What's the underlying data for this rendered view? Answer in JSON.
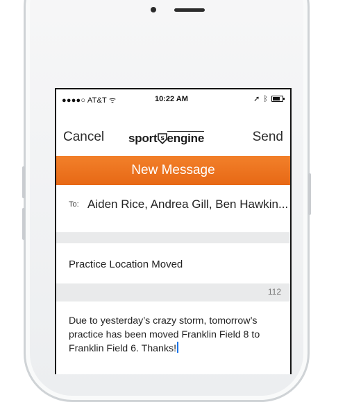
{
  "status_bar": {
    "carrier": "●●●●○ AT&T ᯤ",
    "time": "10:22 AM",
    "battery_level": 0.75
  },
  "nav": {
    "cancel_label": "Cancel",
    "logo_text_left": "sport",
    "logo_text_right": "engine",
    "send_label": "Send"
  },
  "banner": {
    "title": "New Message"
  },
  "to_field": {
    "label": "To:",
    "value": "Aiden Rice, Andrea Gill, Ben Hawkin..."
  },
  "subject": {
    "value": "Practice Location Moved"
  },
  "counter": {
    "value": "112"
  },
  "message": {
    "value": "Due to yesterday’s crazy storm, tomorrow’s practice has been moved Franklin Field 8 to Franklin Field 6. Thanks!"
  },
  "colors": {
    "accent_orange": "#e96e1c",
    "section_gray": "#e9eaeb"
  }
}
